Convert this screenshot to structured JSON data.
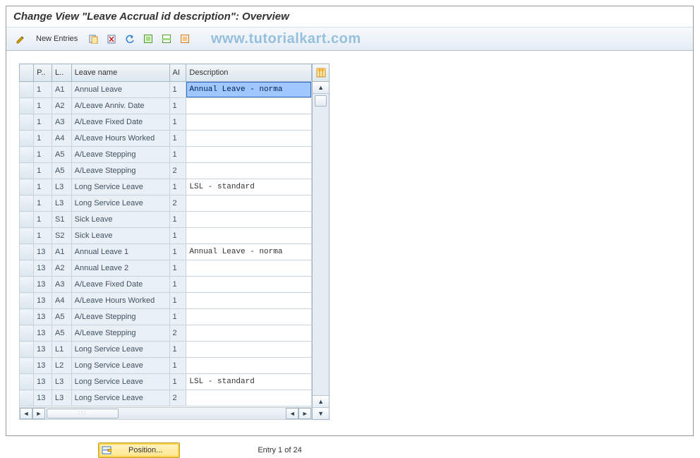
{
  "title": "Change View \"Leave Accrual id description\": Overview",
  "watermark": "www.tutorialkart.com",
  "toolbar": {
    "new_entries": "New Entries"
  },
  "columns": {
    "p": "P..",
    "l": "L..",
    "name": "Leave name",
    "ai": "AI",
    "desc": "Description"
  },
  "rows": [
    {
      "p": "1",
      "l": "A1",
      "name": "Annual Leave",
      "ai": "1",
      "desc": "Annual Leave - norma",
      "sel": true
    },
    {
      "p": "1",
      "l": "A2",
      "name": "A/Leave Anniv. Date",
      "ai": "1",
      "desc": ""
    },
    {
      "p": "1",
      "l": "A3",
      "name": "A/Leave Fixed Date",
      "ai": "1",
      "desc": ""
    },
    {
      "p": "1",
      "l": "A4",
      "name": "A/Leave Hours Worked",
      "ai": "1",
      "desc": ""
    },
    {
      "p": "1",
      "l": "A5",
      "name": "A/Leave Stepping",
      "ai": "1",
      "desc": ""
    },
    {
      "p": "1",
      "l": "A5",
      "name": "A/Leave Stepping",
      "ai": "2",
      "desc": ""
    },
    {
      "p": "1",
      "l": "L3",
      "name": "Long Service Leave",
      "ai": "1",
      "desc": "LSL - standard"
    },
    {
      "p": "1",
      "l": "L3",
      "name": "Long Service Leave",
      "ai": "2",
      "desc": ""
    },
    {
      "p": "1",
      "l": "S1",
      "name": "Sick Leave",
      "ai": "1",
      "desc": ""
    },
    {
      "p": "1",
      "l": "S2",
      "name": "Sick Leave",
      "ai": "1",
      "desc": ""
    },
    {
      "p": "13",
      "l": "A1",
      "name": "Annual Leave 1",
      "ai": "1",
      "desc": "Annual Leave - norma"
    },
    {
      "p": "13",
      "l": "A2",
      "name": "Annual Leave 2",
      "ai": "1",
      "desc": ""
    },
    {
      "p": "13",
      "l": "A3",
      "name": "A/Leave Fixed Date",
      "ai": "1",
      "desc": ""
    },
    {
      "p": "13",
      "l": "A4",
      "name": "A/Leave Hours Worked",
      "ai": "1",
      "desc": ""
    },
    {
      "p": "13",
      "l": "A5",
      "name": "A/Leave Stepping",
      "ai": "1",
      "desc": ""
    },
    {
      "p": "13",
      "l": "A5",
      "name": "A/Leave Stepping",
      "ai": "2",
      "desc": ""
    },
    {
      "p": "13",
      "l": "L1",
      "name": "Long Service Leave",
      "ai": "1",
      "desc": ""
    },
    {
      "p": "13",
      "l": "L2",
      "name": "Long Service Leave",
      "ai": "1",
      "desc": ""
    },
    {
      "p": "13",
      "l": "L3",
      "name": "Long Service Leave",
      "ai": "1",
      "desc": "LSL - standard"
    },
    {
      "p": "13",
      "l": "L3",
      "name": "Long Service Leave",
      "ai": "2",
      "desc": ""
    }
  ],
  "footer": {
    "position_label": "Position...",
    "entry_text": "Entry 1 of 24"
  }
}
